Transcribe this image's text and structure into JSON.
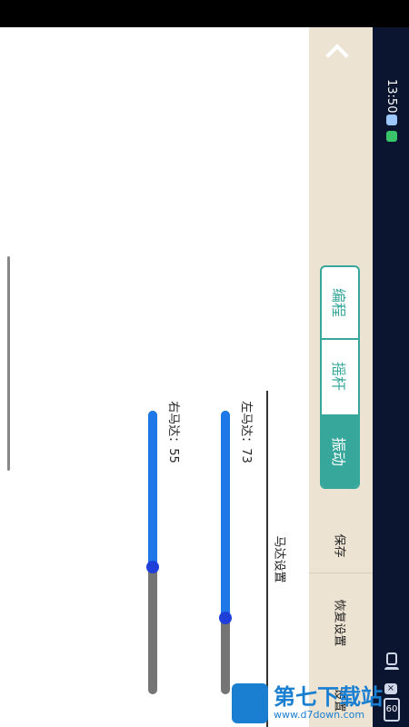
{
  "status": {
    "time": "13:50",
    "battery": "60"
  },
  "tabs": [
    {
      "label": "编程",
      "active": false
    },
    {
      "label": "摇杆",
      "active": false
    },
    {
      "label": "振动",
      "active": true
    }
  ],
  "actions": {
    "save": "保存",
    "restore": "恢复设置",
    "more": "设置"
  },
  "section": {
    "title": "马达设置"
  },
  "motors": [
    {
      "label": "左马达：73",
      "value": 73,
      "max": 100
    },
    {
      "label": "右马达：55",
      "value": 55,
      "max": 100
    }
  ],
  "colors": {
    "accent": "#36a79a",
    "slider_fill": "#1e78e8",
    "slider_track": "#757575",
    "nav_bg": "#ece3d3"
  },
  "watermark": {
    "main": "第七下载站",
    "url": "www.d7down.com"
  }
}
